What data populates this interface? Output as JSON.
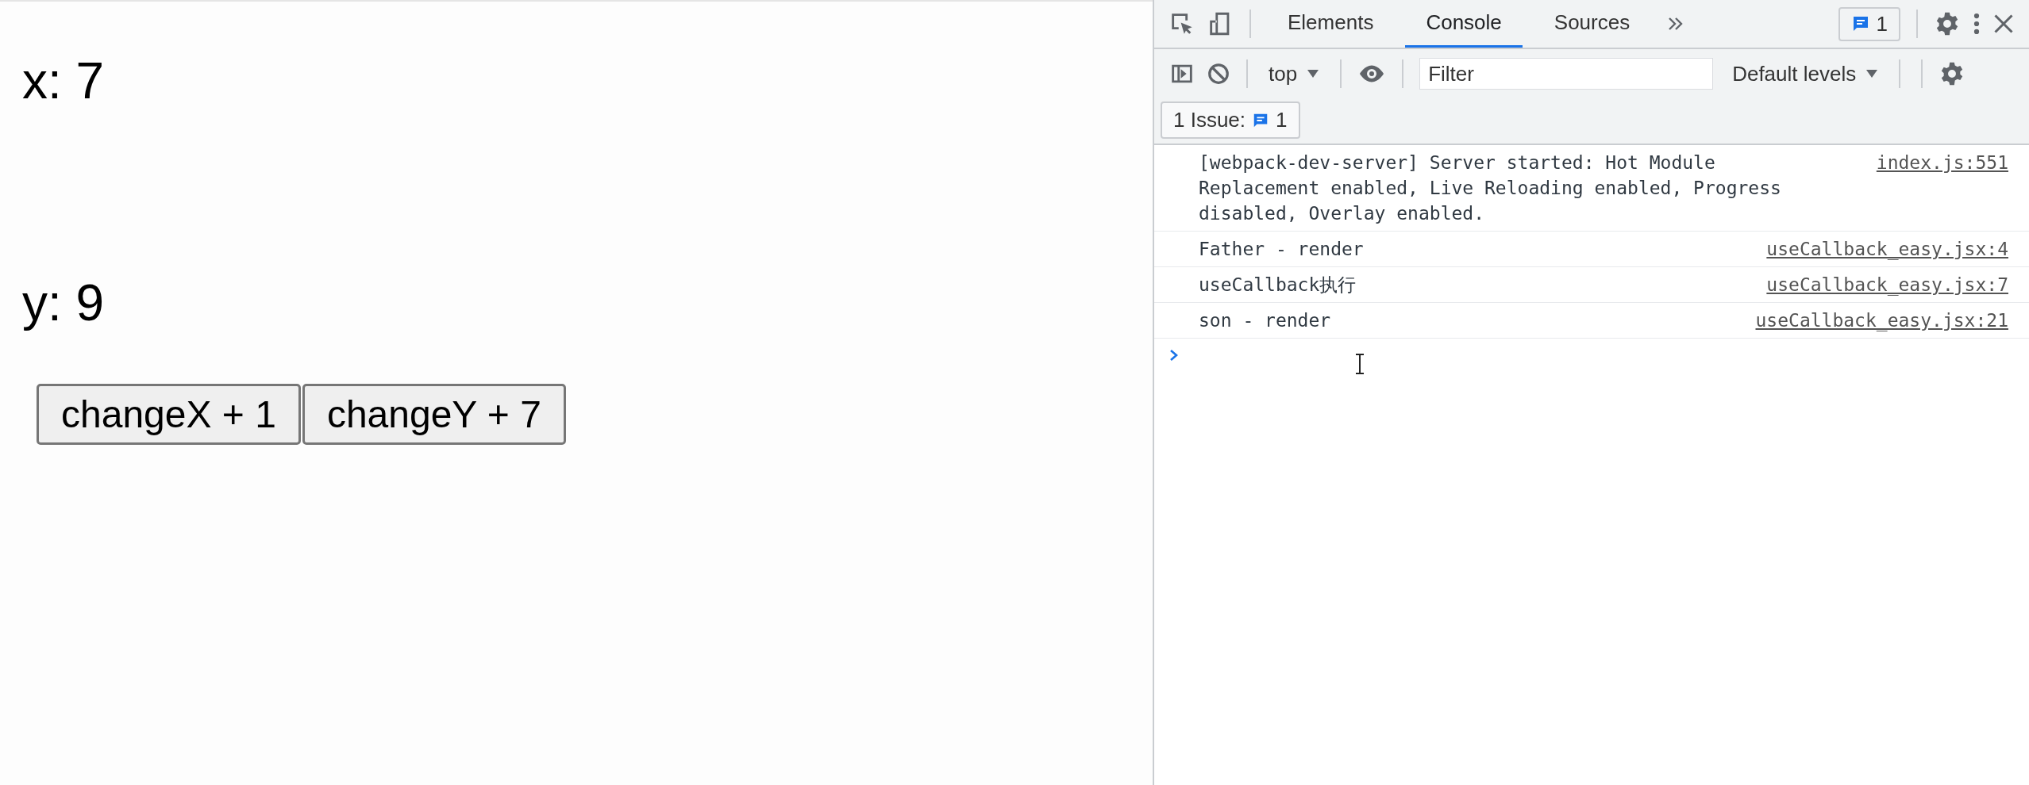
{
  "page": {
    "labels": [
      "x: 7",
      "y: 9"
    ],
    "buttons": [
      "changeX + 1",
      "changeY + 7"
    ]
  },
  "devtools": {
    "tabs": [
      {
        "label": "Elements",
        "selected": false
      },
      {
        "label": "Console",
        "selected": true
      },
      {
        "label": "Sources",
        "selected": false
      }
    ],
    "issues_badge": "1",
    "context": "top",
    "filter": {
      "placeholder": "Filter"
    },
    "levels": "Default levels",
    "issue_bar": {
      "label": "1 Issue:",
      "count": "1"
    },
    "messages": [
      {
        "text": "[webpack-dev-server] Server started: Hot Module Replacement enabled, Live Reloading enabled, Progress disabled, Overlay enabled.",
        "source": "index.js:551"
      },
      {
        "text": "Father - render",
        "source": "useCallback_easy.jsx:4"
      },
      {
        "text": "useCallback执行",
        "source": "useCallback_easy.jsx:7"
      },
      {
        "text": "son - render",
        "source": "useCallback_easy.jsx:21"
      }
    ]
  }
}
